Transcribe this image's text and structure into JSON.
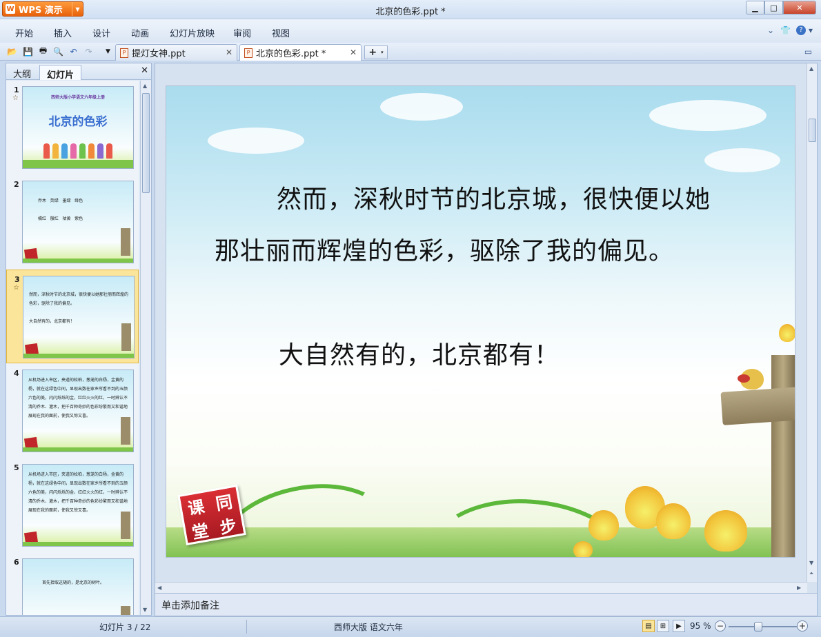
{
  "app": {
    "name": "WPS 演示",
    "logo": "W"
  },
  "window": {
    "title": "北京的色彩.ppt *"
  },
  "menu": [
    "开始",
    "插入",
    "设计",
    "动画",
    "幻灯片放映",
    "审阅",
    "视图"
  ],
  "tabs": [
    {
      "label": "提灯女神.ppt"
    },
    {
      "label": "北京的色彩.ppt *"
    }
  ],
  "panel": {
    "tab_outline": "大纲",
    "tab_slides": "幻灯片"
  },
  "thumbnails": [
    {
      "num": "1",
      "line1": "西师大版小学语文六年级上册",
      "line2": "北京的色彩"
    },
    {
      "num": "2",
      "text": "乔木   荧绿   墨绿   绛色\n\n橘红   殷红   枯黄   紫色"
    },
    {
      "num": "3",
      "text": "然而，深秋时节的北京城，很快便以她那壮丽而辉煌的色彩，驱除了我的偏见。\n\n大自然有的，北京都有！"
    },
    {
      "num": "4",
      "text": "从机场进入市区，夹道的松柏，葱茏的白杨，金黄的杨，就在这绿色中间，显现出数在家乡所看不到的五颜六色的美，闪闪烁烁的金，红红火火的红，一时辨认不清的乔木、灌木，把千百种奇妙的色彩纷繁而又和谐地展现在我的面前，使我又惊又喜。"
    },
    {
      "num": "5",
      "text": "从机场进入市区，夹道的松柏，葱茏的白杨，金黄的杨，就在这绿色中间，显现出数在家乡所看不到的五颜六色的美，闪闪烁烁的金，红红火火的红，一时辨认不清的乔木、灌木，把千百种奇妙的色彩纷繁而又和谐地展现在我的面前，使我又惊又喜。"
    },
    {
      "num": "6",
      "text": "首先拾取这随的，是北京的树叶。"
    }
  ],
  "slide": {
    "line1": "然而，深秋时节的北京城，很快便以她",
    "line2": "那壮丽而辉煌的色彩，驱除了我的偏见。",
    "line3": "大自然有的，北京都有！",
    "stamp": [
      "课",
      "同",
      "堂",
      "步"
    ]
  },
  "notes_placeholder": "单击添加备注",
  "status": {
    "slide_counter": "幻灯片 3 / 22",
    "template": "西师大版 语文六年",
    "zoom": "95 %",
    "zoom_level": 0.45
  },
  "colors": {
    "accent": "#e8620c",
    "selected_thumb": "#fbe59a",
    "title_blue": "#3a6fd0"
  }
}
